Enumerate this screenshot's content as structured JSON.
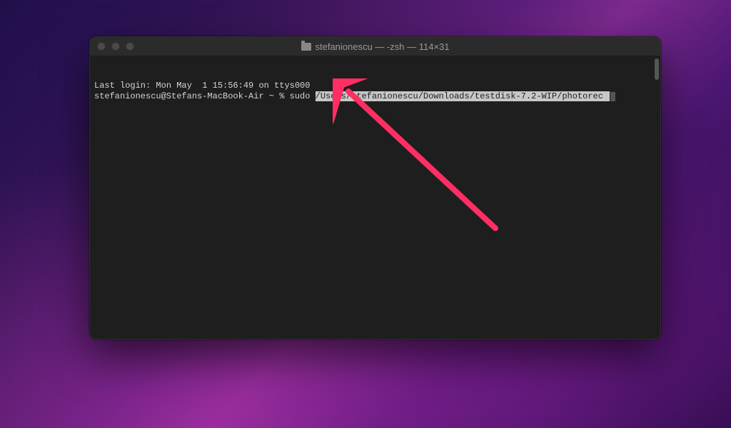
{
  "window": {
    "title": "stefanionescu — -zsh — 114×31"
  },
  "terminal": {
    "line1": "Last login: Mon May  1 15:56:49 on ttys000",
    "prompt": "stefanionescu@Stefans-MacBook-Air ~ % ",
    "command_prefix": "sudo ",
    "highlighted_path": "/Users/stefanionescu/Downloads/testdisk-7.2-WIP/photorec "
  }
}
